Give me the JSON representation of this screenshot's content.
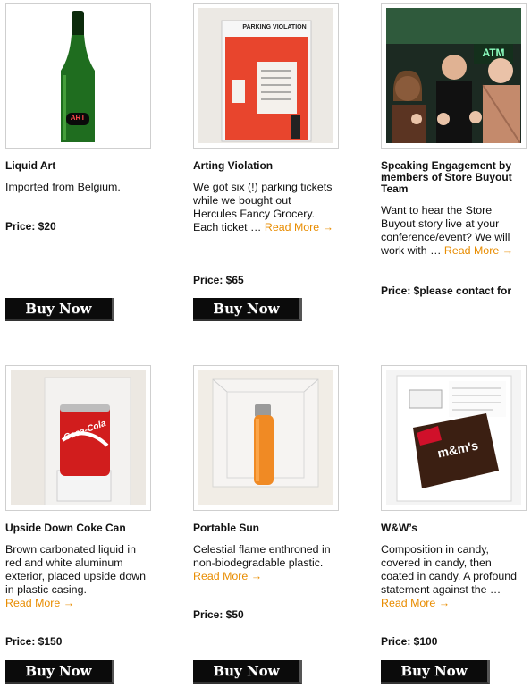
{
  "products": [
    {
      "title": "Liquid Art",
      "desc": "Imported from Belgium.",
      "more": "",
      "price": "Price: $20",
      "buy": "Buy Now",
      "image": "green-beer-bottle"
    },
    {
      "title": "Arting Violation",
      "desc": "We got six (!) parking tickets while we bought out Hercules Fancy Grocery.  Each ticket … ",
      "more": "Read More →",
      "price": "Price: $65",
      "buy": "Buy Now",
      "image": "parking-violation-ticket",
      "image_text": "PARKING VIOLATION"
    },
    {
      "title": "Speaking Engagement by members of Store Buyout Team",
      "desc": "Want to hear the Store Buyout story live at your conference/event? We will work with … ",
      "more": "Read More →",
      "price": "Price: $please contact for more details",
      "buy": "Buy Now",
      "image": "three-people-pointing",
      "image_text": "ATM"
    },
    {
      "title": "Upside Down Coke Can",
      "desc": "Brown carbonated liquid in red and white aluminum exterior, placed upside down in plastic casing.",
      "more": "Read More →",
      "price": "Price: $150",
      "buy": "Buy Now",
      "image": "coke-can-in-case",
      "image_text": "Coca-Cola"
    },
    {
      "title": "Portable Sun",
      "desc": "Celestial flame enthroned in non-biodegradable plastic.",
      "more": "Read More →",
      "price": "Price: $50",
      "buy": "Buy Now",
      "image": "orange-lighter-in-case"
    },
    {
      "title": "W&W’s",
      "desc": "Composition in candy, covered in candy, then coated in candy. A profound statement against the … ",
      "more": "Read More →",
      "price": "Price: $100",
      "buy": "Buy Now",
      "image": "candy-wrapper-in-case",
      "image_text": "m&m's"
    }
  ],
  "colors": {
    "link": "#e88c00",
    "button_bg": "#0b0b0b"
  }
}
